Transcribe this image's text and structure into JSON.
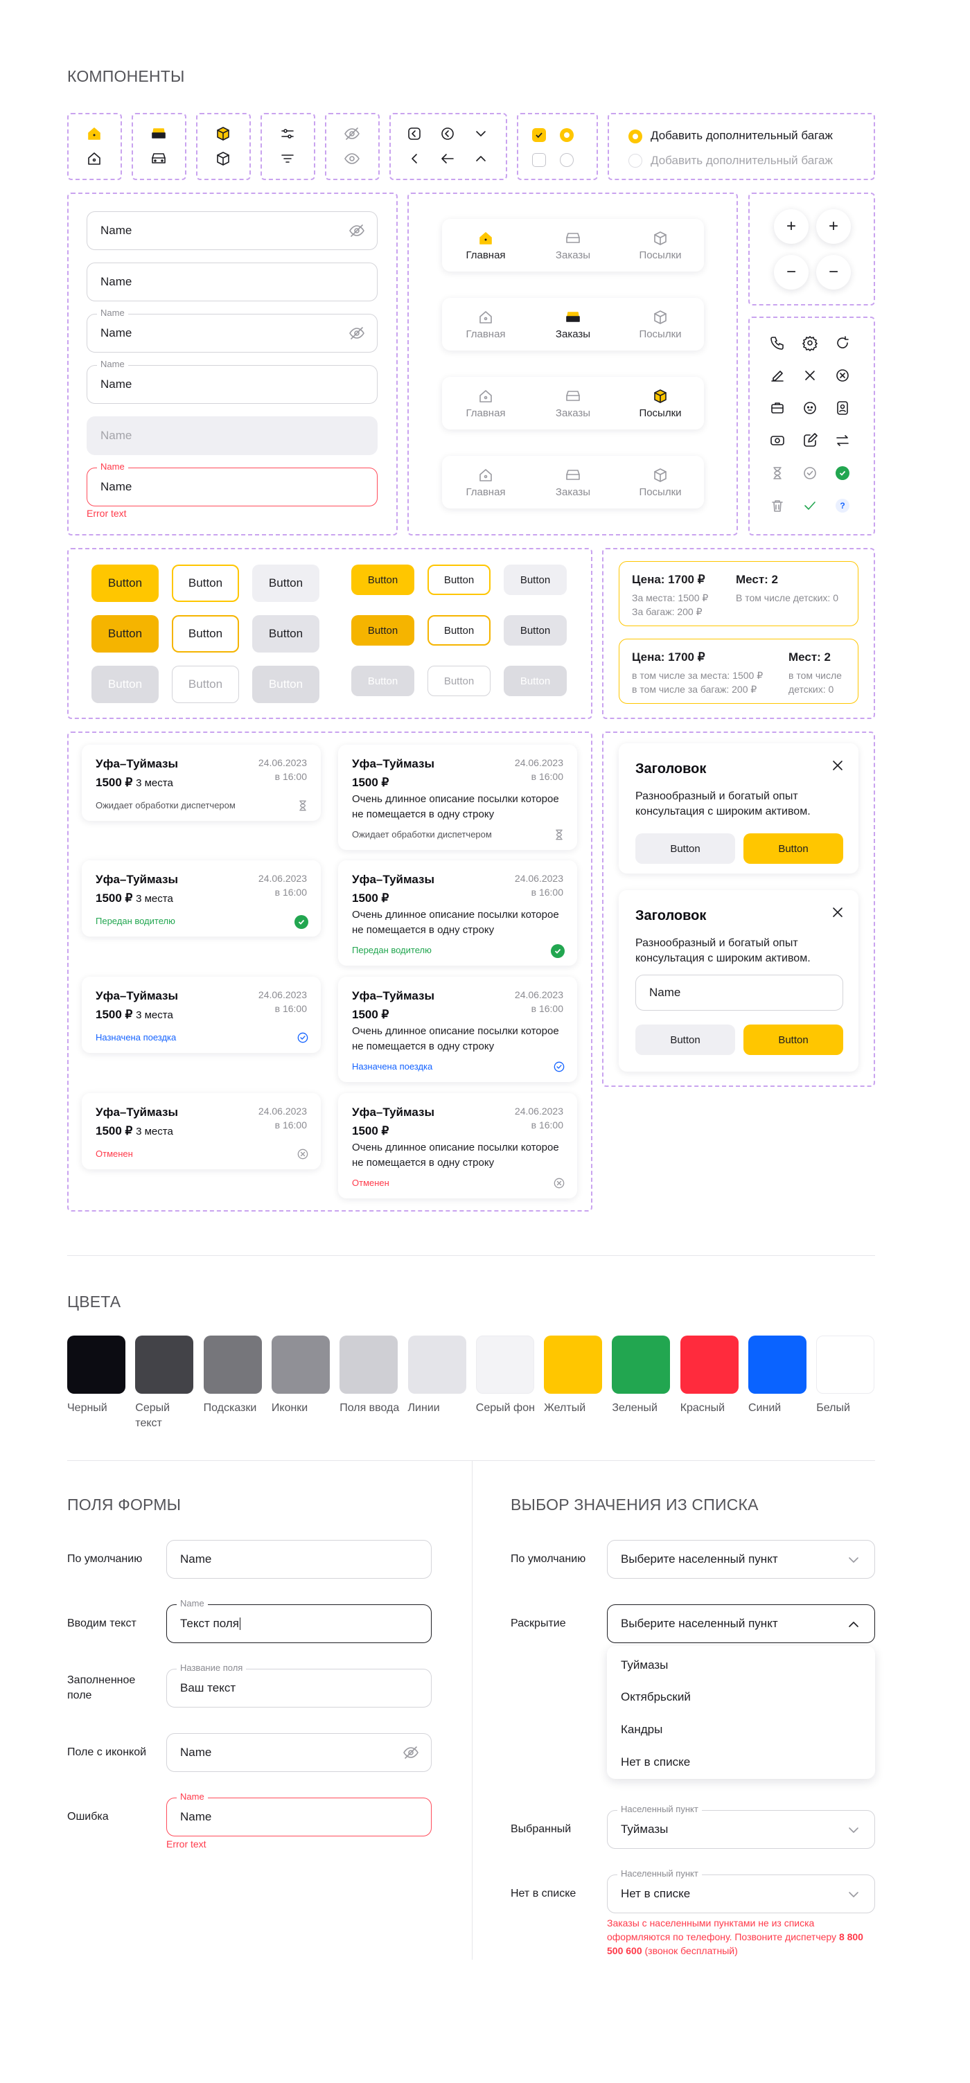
{
  "components": {
    "title": "КОМПОНЕНТЫ",
    "radio": {
      "option1": "Добавить дополнительный багаж",
      "option2": "Добавить дополнительный багаж"
    },
    "inputs": [
      {
        "value": "Name"
      },
      {
        "value": "Name"
      },
      {
        "label": "Name",
        "value": "Name"
      },
      {
        "label": "Name",
        "value": "Name"
      },
      {
        "value": "Name"
      },
      {
        "label": "Name",
        "value": "Name",
        "error": "Error text"
      }
    ],
    "tabbar": {
      "home": "Главная",
      "orders": "Заказы",
      "parcels": "Посылки"
    },
    "buttons": {
      "label": "Button"
    },
    "price_cards": [
      {
        "price": "Цена: 1700 ₽",
        "seats": "Мест: 2",
        "line1": "За места: 1500 ₽",
        "line2": "За багаж: 200 ₽",
        "kids": "В том числе детских: 0"
      },
      {
        "price": "Цена: 1700 ₽",
        "seats": "Мест: 2",
        "line1": "в том числе за места: 1500 ₽",
        "line2": "в том числе за багаж: 200 ₽",
        "kids1": "в том числе",
        "kids2": "детских: 0"
      }
    ],
    "orders_left": [
      {
        "route": "Уфа–Туймазы",
        "price": "1500 ₽",
        "seats": "3 места",
        "date": "24.06.2023",
        "time": "в 16:00",
        "status": "Ожидает обработки диспетчером",
        "status_color": "#545459"
      },
      {
        "route": "Уфа–Туймазы",
        "price": "1500 ₽",
        "seats": "3 места",
        "date": "24.06.2023",
        "time": "в 16:00",
        "status": "Передан водителю",
        "status_color": "#22a650"
      },
      {
        "route": "Уфа–Туймазы",
        "price": "1500 ₽",
        "seats": "3 места",
        "date": "24.06.2023",
        "time": "в 16:00",
        "status": "Назначена поездка",
        "status_color": "#1463ff"
      },
      {
        "route": "Уфа–Туймазы",
        "price": "1500 ₽",
        "seats": "3 места",
        "date": "24.06.2023",
        "time": "в 16:00",
        "status": "Отменен",
        "status_color": "#ff3a4a"
      }
    ],
    "orders_right": [
      {
        "route": "Уфа–Туймазы",
        "price": "1500 ₽",
        "date": "24.06.2023",
        "time": "в 16:00",
        "desc": "Очень длинное описание посылки которое не помещается в одну строку",
        "status": "Ожидает обработки диспетчером"
      },
      {
        "route": "Уфа–Туймазы",
        "price": "1500 ₽",
        "date": "24.06.2023",
        "time": "в 16:00",
        "desc": "Очень длинное описание посылки которое не помещается в одну строку",
        "status": "Передан водителю"
      },
      {
        "route": "Уфа–Туймазы",
        "price": "1500 ₽",
        "date": "24.06.2023",
        "time": "в 16:00",
        "desc": "Очень длинное описание посылки которое не помещается в одну строку",
        "status": "Назначена поездка"
      },
      {
        "route": "Уфа–Туймазы",
        "price": "1500 ₽",
        "date": "24.06.2023",
        "time": "в 16:00",
        "desc": "Очень длинное описание посылки которое не помещается в одну строку",
        "status": "Отменен"
      }
    ],
    "dialogs": [
      {
        "title": "Заголовок",
        "text": "Разнообразный и богатый опыт консультация с широким активом.",
        "cancel": "Button",
        "ok": "Button"
      },
      {
        "title": "Заголовок",
        "text": "Разнообразный и богатый опыт консультация с широким активом.",
        "input": "Name",
        "cancel": "Button",
        "ok": "Button"
      }
    ]
  },
  "colors": {
    "title": "ЦВЕТА",
    "swatches": [
      {
        "name": "Черный",
        "hex": "#0c0c12"
      },
      {
        "name": "Серый текст",
        "hex": "#434348"
      },
      {
        "name": "Подсказки",
        "hex": "#76767b"
      },
      {
        "name": "Иконки",
        "hex": "#909096"
      },
      {
        "name": "Поля ввода",
        "hex": "#cfcfd4"
      },
      {
        "name": "Линии",
        "hex": "#e4e4e9"
      },
      {
        "name": "Серый фон",
        "hex": "#f3f3f6"
      },
      {
        "name": "Желтый",
        "hex": "#ffc600"
      },
      {
        "name": "Зеленый",
        "hex": "#22a650"
      },
      {
        "name": "Красный",
        "hex": "#ff2b3d"
      },
      {
        "name": "Синий",
        "hex": "#0a63ff"
      },
      {
        "name": "Белый",
        "hex": "#ffffff"
      }
    ]
  },
  "form_fields": {
    "title": "ПОЛЯ ФОРМЫ",
    "rows": [
      {
        "label": "По умолчанию",
        "value": "Name"
      },
      {
        "label": "Вводим текст",
        "field_label": "Name",
        "value": "Текст поля"
      },
      {
        "label": "Заполненное поле",
        "field_label": "Название поля",
        "value": "Ваш текст"
      },
      {
        "label": "Поле с иконкой",
        "value": "Name"
      },
      {
        "label": "Ошибка",
        "field_label": "Name",
        "value": "Name",
        "error": "Error text"
      }
    ]
  },
  "select": {
    "title": "ВЫБОР ЗНАЧЕНИЯ ИЗ СПИСКА",
    "default_label": "По умолчанию",
    "default_value": "Выберите населенный пункт",
    "open_label": "Раскрытие",
    "open_value": "Выберите населенный пункт",
    "options": [
      "Туймазы",
      "Октябрьский",
      "Кандры",
      "Нет в списке"
    ],
    "selected_label": "Выбранный",
    "selected_field_label": "Населенный пункт",
    "selected_value": "Туймазы",
    "notlisted_label": "Нет в списке",
    "notlisted_field_label": "Населенный пункт",
    "notlisted_value": "Нет в списке",
    "notice": "Заказы с населенными пунктами не из списка оформляются по телефону. Позвоните диспетчеру",
    "phone": "8 800 500 600",
    "phone_note": "(звонок бесплатный)"
  }
}
